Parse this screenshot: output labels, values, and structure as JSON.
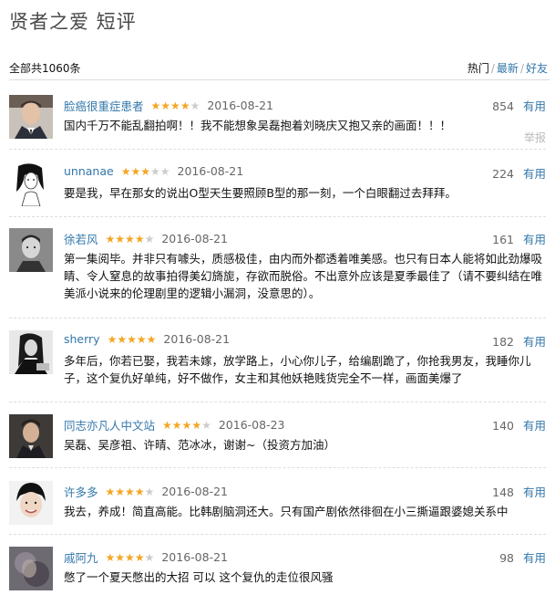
{
  "header": {
    "title": "贤者之爱 短评",
    "total": "全部共1060条",
    "sort": [
      "热门",
      "最新",
      "好友"
    ]
  },
  "colors": {
    "link": "#3377aa",
    "star": "#f4a623"
  },
  "reviews": [
    {
      "user": "脸癌很重症患者",
      "rating": 4,
      "date": "2016-08-21",
      "votes": "854",
      "useful": "有用",
      "report": "举报",
      "content": "国内千万不能乱翻拍啊！！我不能想象吴磊抱着刘晓庆又抱又亲的画面！！！",
      "avatar": "man-in-suit"
    },
    {
      "user": "unnanae",
      "rating": 3,
      "date": "2016-08-21",
      "votes": "224",
      "useful": "有用",
      "content": "要是我，早在那女的说出O型天生要照顾B型的那一刻，一个白眼翻过去拜拜。",
      "avatar": "sketch-girl"
    },
    {
      "user": "徐若风",
      "rating": 4,
      "date": "2016-08-21",
      "votes": "161",
      "useful": "有用",
      "content": "第一集阅毕。并非只有噱头，质感极佳，由内而外都透着唯美感。也只有日本人能将如此劲爆吸睛、令人窒息的故事拍得美幻旖旎，存欲而脱俗。不出意外应该是夏季最佳了（请不要纠结在唯美派小说来的伦理剧里的逻辑小漏洞，没意思的）。",
      "avatar": "bw-boy"
    },
    {
      "user": "sherry",
      "rating": 5,
      "date": "2016-08-21",
      "votes": "182",
      "useful": "有用",
      "content": "多年后，你若已娶，我若未嫁，放学路上，小心你儿子，给编剧跪了，你抢我男友，我睡你儿子，这个复仇好单纯，好不做作，女主和其他妖艳贱货完全不一样，画面美爆了",
      "avatar": "bw-woman"
    },
    {
      "user": "同志亦凡人中文站",
      "rating": 4,
      "date": "2016-08-23",
      "votes": "140",
      "useful": "有用",
      "content": "吴磊、吴彦祖、许晴、范冰冰，谢谢~（投资方加油）",
      "avatar": "man-portrait"
    },
    {
      "user": "许多多",
      "rating": 4,
      "date": "2016-08-21",
      "votes": "148",
      "useful": "有用",
      "content": "我去，养成！简直高能。比韩剧脑洞还大。只有国产剧依然徘徊在小三撕逼跟婆媳关系中",
      "avatar": "smiling-face"
    },
    {
      "user": "戚阿九",
      "rating": 4,
      "date": "2016-08-21",
      "votes": "98",
      "useful": "有用",
      "content": "憋了一个夏天憋出的大招 可以 这个复仇的走位很风骚",
      "avatar": "blurry-photo"
    }
  ]
}
